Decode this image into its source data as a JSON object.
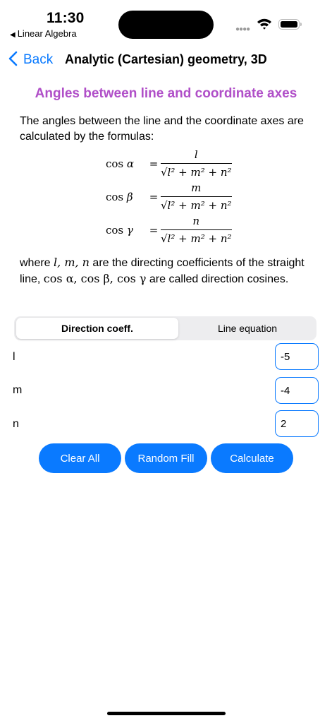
{
  "status_bar": {
    "time": "11:30",
    "back_app": "Linear Algebra"
  },
  "nav": {
    "back_label": "Back",
    "title": "Analytic (Cartesian) geometry, 3D"
  },
  "content": {
    "section_title": "Angles between line and coordinate axes",
    "intro": "The angles between the line and the coordinate axes are calculated by the formulas:",
    "formulas": [
      {
        "lhs_fn": "cos",
        "lhs_var": "α",
        "eq": "=",
        "num": "l",
        "den": "√l² + m² + n²"
      },
      {
        "lhs_fn": "cos",
        "lhs_var": "β",
        "eq": "=",
        "num": "m",
        "den": "√l² + m² + n²"
      },
      {
        "lhs_fn": "cos",
        "lhs_var": "γ",
        "eq": "=",
        "num": "n",
        "den": "√l² + m² + n²"
      }
    ],
    "explanation": {
      "a": "where ",
      "vars": "l, m, n",
      "b": " are the directing coefficients of the straight line, ",
      "cosines": "cos α, cos β, cos γ",
      "c": " are called direction cosines."
    }
  },
  "segment": {
    "tab1": "Direction coeff.",
    "tab2": "Line equation",
    "selected": "Direction coeff."
  },
  "inputs": [
    {
      "label": "l",
      "value": "-5"
    },
    {
      "label": "m",
      "value": "-4"
    },
    {
      "label": "n",
      "value": "2"
    }
  ],
  "buttons": {
    "clear": "Clear All",
    "random": "Random Fill",
    "calculate": "Calculate"
  },
  "colors": {
    "accent": "#0a7aff",
    "section_title": "#b04fc8"
  }
}
